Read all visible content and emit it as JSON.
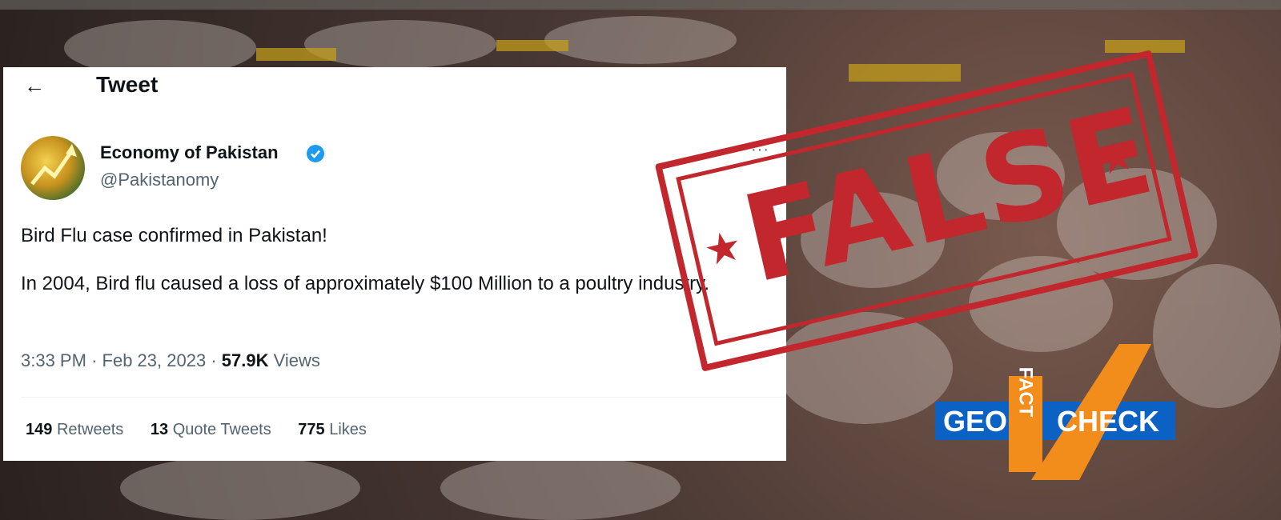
{
  "tweet": {
    "header_title": "Tweet",
    "author_name": "Economy of Pakistan",
    "author_handle": "@Pakistanomy",
    "text_paragraph_1": "Bird Flu case confirmed in Pakistan!",
    "text_paragraph_2": "In 2004, Bird flu caused a loss of approximately $100 Million to a poultry industry.",
    "time": "3:33 PM",
    "date": "Feb 23, 2023",
    "views_count": "57.9K",
    "views_label": "Views",
    "retweets_count": "149",
    "retweets_label": "Retweets",
    "quote_count": "13",
    "quote_label": "Quote Tweets",
    "likes_count": "775",
    "likes_label": "Likes",
    "more_glyph": "···"
  },
  "stamp": {
    "text": "FALSE",
    "color": "#c1272d"
  },
  "logo": {
    "left": "GEO",
    "middle": "FACT",
    "right": "CHECK"
  },
  "colors": {
    "verified": "#1d9bf0",
    "logo_blue": "#0b62c4",
    "logo_orange": "#f28c1b"
  }
}
